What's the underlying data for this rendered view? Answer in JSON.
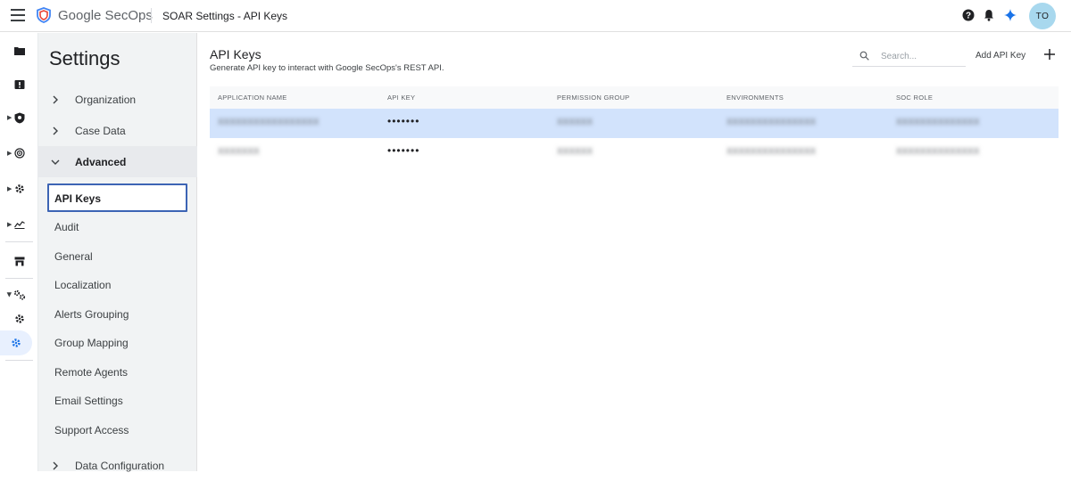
{
  "header": {
    "brand": "Google SecOps",
    "page_name": "SOAR Settings - API Keys",
    "avatar_initials": "TO"
  },
  "settings": {
    "title": "Settings",
    "groups": [
      {
        "label": "Organization"
      },
      {
        "label": "Case Data"
      },
      {
        "label": "Advanced"
      },
      {
        "label": "Data Configuration"
      }
    ],
    "advanced_items": [
      {
        "label": "API Keys"
      },
      {
        "label": "Audit"
      },
      {
        "label": "General"
      },
      {
        "label": "Localization"
      },
      {
        "label": "Alerts Grouping"
      },
      {
        "label": "Group Mapping"
      },
      {
        "label": "Remote Agents"
      },
      {
        "label": "Email Settings"
      },
      {
        "label": "Support Access"
      }
    ]
  },
  "main": {
    "title": "API Keys",
    "subtitle": "Generate API key to interact with Google SecOps's REST API.",
    "search_placeholder": "Search...",
    "add_label": "Add API Key",
    "columns": [
      "APPLICATION NAME",
      "API KEY",
      "PERMISSION GROUP",
      "ENVIRONMENTS",
      "SOC ROLE"
    ],
    "rows": [
      {
        "application_name": "XXXXXXXXXXXXXXXXX",
        "api_key": "•••••••",
        "permission_group": "XXXXXX",
        "environments": "XXXXXXXXXXXXXXX",
        "soc_role": "XXXXXXXXXXXXXX"
      },
      {
        "application_name": "XXXXXXX",
        "api_key": "•••••••",
        "permission_group": "XXXXXX",
        "environments": "XXXXXXXXXXXXXXX",
        "soc_role": "XXXXXXXXXXXXXX"
      }
    ]
  },
  "colors": {
    "accent": "#1a73e8",
    "selected_row": "#d2e3fc",
    "active_border": "#3c64b4",
    "avatar": "#a8d8ee"
  }
}
